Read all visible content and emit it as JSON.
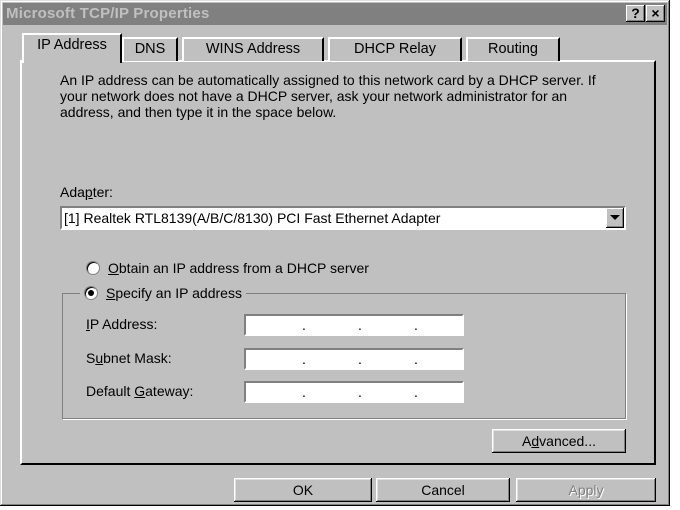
{
  "window": {
    "title": "Microsoft TCP/IP Properties",
    "help_label": "?",
    "close_label": "×"
  },
  "tabs": [
    {
      "label": "IP Address",
      "active": true
    },
    {
      "label": "DNS",
      "active": false
    },
    {
      "label": "WINS Address",
      "active": false
    },
    {
      "label": "DHCP Relay",
      "active": false
    },
    {
      "label": "Routing",
      "active": false
    }
  ],
  "intro_text": "An IP address can be automatically assigned to this network card by a DHCP server.  If your network does not have a DHCP server, ask your network administrator for an address, and then type it in the space below.",
  "adapter": {
    "label_pre": "Ada",
    "label_accel": "p",
    "label_post": "ter:",
    "selected": "[1] Realtek RTL8139(A/B/C/8130) PCI Fast Ethernet Adapter"
  },
  "radio_dhcp": {
    "accel": "O",
    "rest": "btain an IP address from a DHCP server",
    "checked": false
  },
  "radio_specify": {
    "accel": "S",
    "rest": "pecify an IP address",
    "checked": true
  },
  "fields": {
    "ip": {
      "accel": "I",
      "rest": "P Address:",
      "value": ""
    },
    "subnet": {
      "pre": "S",
      "accel": "u",
      "rest": "bnet Mask:",
      "value": ""
    },
    "gateway": {
      "pre": "Default ",
      "accel": "G",
      "rest": "ateway:",
      "value": ""
    }
  },
  "buttons": {
    "advanced": {
      "pre": "A",
      "accel": "d",
      "rest": "vanced..."
    },
    "ok": "OK",
    "cancel": "Cancel",
    "apply": "Apply"
  },
  "colors": {
    "face": "#c0c0c0",
    "titlebar_inactive": "#808080"
  }
}
